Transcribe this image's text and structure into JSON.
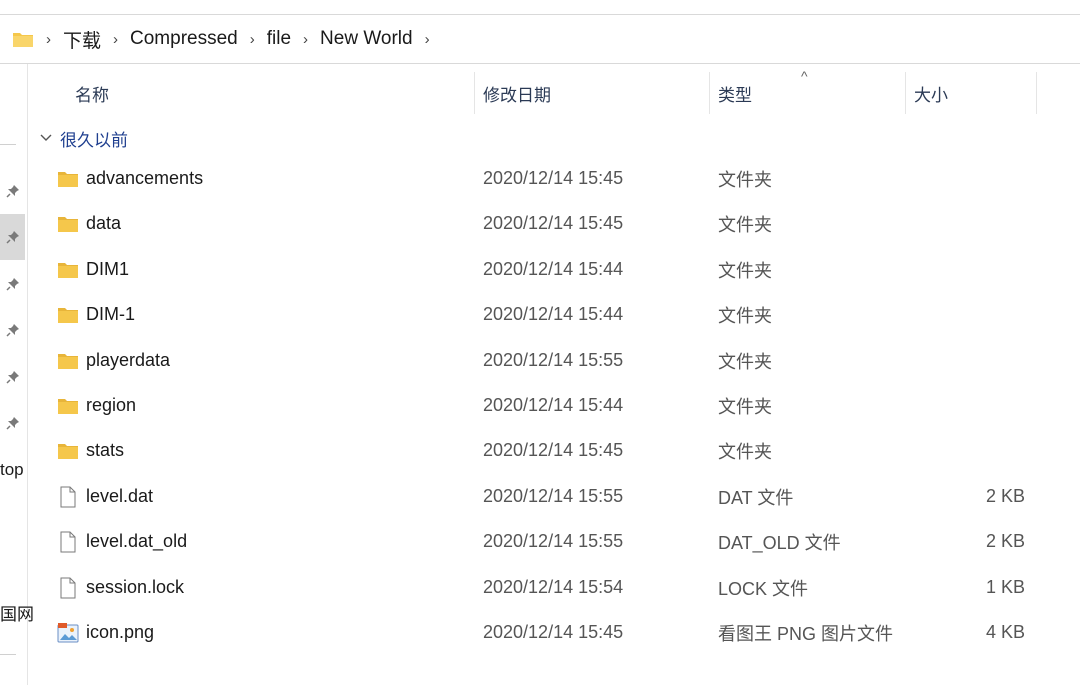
{
  "breadcrumb": [
    "下载",
    "Compressed",
    "file",
    "New World"
  ],
  "columns": {
    "name": "名称",
    "date": "修改日期",
    "type": "类型",
    "size": "大小"
  },
  "group_label": "很久以前",
  "nav": {
    "text1": "top",
    "text2": "国网"
  },
  "icons": {
    "folder": "folder-icon",
    "file": "file-icon",
    "image": "image-file-icon",
    "pin": "pin-icon"
  },
  "colors": {
    "folder": "#f5c74b",
    "group": "#1f3f8f",
    "header": "#2b3a55"
  },
  "files": [
    {
      "name": "advancements",
      "date": "2020/12/14 15:45",
      "type": "文件夹",
      "size": "",
      "kind": "folder"
    },
    {
      "name": "data",
      "date": "2020/12/14 15:45",
      "type": "文件夹",
      "size": "",
      "kind": "folder"
    },
    {
      "name": "DIM1",
      "date": "2020/12/14 15:44",
      "type": "文件夹",
      "size": "",
      "kind": "folder"
    },
    {
      "name": "DIM-1",
      "date": "2020/12/14 15:44",
      "type": "文件夹",
      "size": "",
      "kind": "folder"
    },
    {
      "name": "playerdata",
      "date": "2020/12/14 15:55",
      "type": "文件夹",
      "size": "",
      "kind": "folder"
    },
    {
      "name": "region",
      "date": "2020/12/14 15:44",
      "type": "文件夹",
      "size": "",
      "kind": "folder"
    },
    {
      "name": "stats",
      "date": "2020/12/14 15:45",
      "type": "文件夹",
      "size": "",
      "kind": "folder"
    },
    {
      "name": "level.dat",
      "date": "2020/12/14 15:55",
      "type": "DAT 文件",
      "size": "2 KB",
      "kind": "file"
    },
    {
      "name": "level.dat_old",
      "date": "2020/12/14 15:55",
      "type": "DAT_OLD 文件",
      "size": "2 KB",
      "kind": "file"
    },
    {
      "name": "session.lock",
      "date": "2020/12/14 15:54",
      "type": "LOCK 文件",
      "size": "1 KB",
      "kind": "file"
    },
    {
      "name": "icon.png",
      "date": "2020/12/14 15:45",
      "type": "看图王 PNG 图片文件",
      "size": "4 KB",
      "kind": "image"
    }
  ]
}
